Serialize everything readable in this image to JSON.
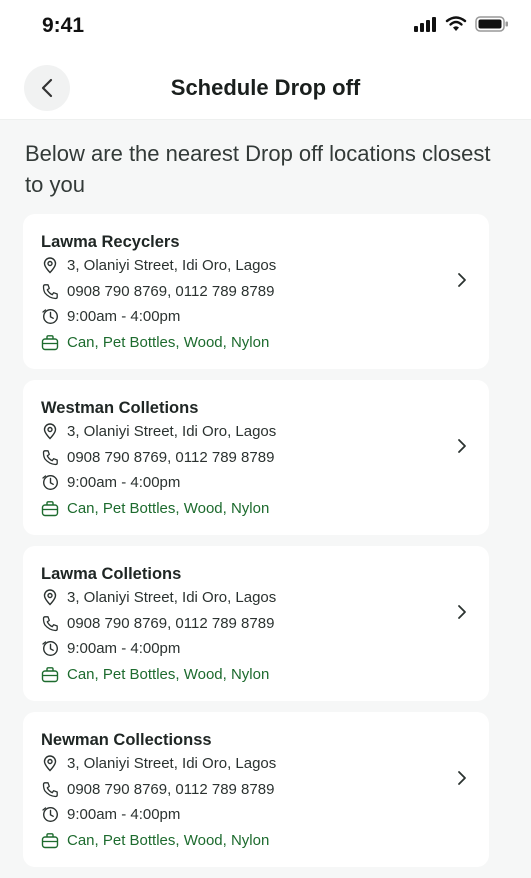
{
  "status": {
    "time": "9:41"
  },
  "header": {
    "title": "Schedule Drop off"
  },
  "intro": "Below are the nearest Drop off locations closest to you",
  "locations": [
    {
      "name": "Lawma Recyclers",
      "address": "3, Olaniyi Street, Idi Oro, Lagos",
      "phone": "0908 790 8769, 0112 789 8789",
      "hours": "9:00am - 4:00pm",
      "materials": "Can, Pet Bottles, Wood, Nylon"
    },
    {
      "name": "Westman Colletions",
      "address": "3, Olaniyi Street, Idi Oro, Lagos",
      "phone": "0908 790 8769, 0112 789 8789",
      "hours": "9:00am - 4:00pm",
      "materials": "Can, Pet Bottles, Wood, Nylon"
    },
    {
      "name": "Lawma Colletions",
      "address": "3, Olaniyi Street, Idi Oro, Lagos",
      "phone": "0908 790 8769, 0112 789 8789",
      "hours": "9:00am - 4:00pm",
      "materials": "Can, Pet Bottles, Wood, Nylon"
    },
    {
      "name": "Newman Collectionss",
      "address": "3, Olaniyi Street, Idi Oro, Lagos",
      "phone": "0908 790 8769, 0112 789 8789",
      "hours": "9:00am - 4:00pm",
      "materials": "Can, Pet Bottles, Wood, Nylon"
    }
  ],
  "icons": {
    "back": "chevron-left-icon",
    "address": "map-pin-icon",
    "phone": "phone-icon",
    "hours": "clock-icon",
    "materials": "bag-icon",
    "open": "chevron-right-icon"
  },
  "colors": {
    "accent": "#1d6b2e",
    "background": "#f6f7f7",
    "card": "#ffffff"
  }
}
